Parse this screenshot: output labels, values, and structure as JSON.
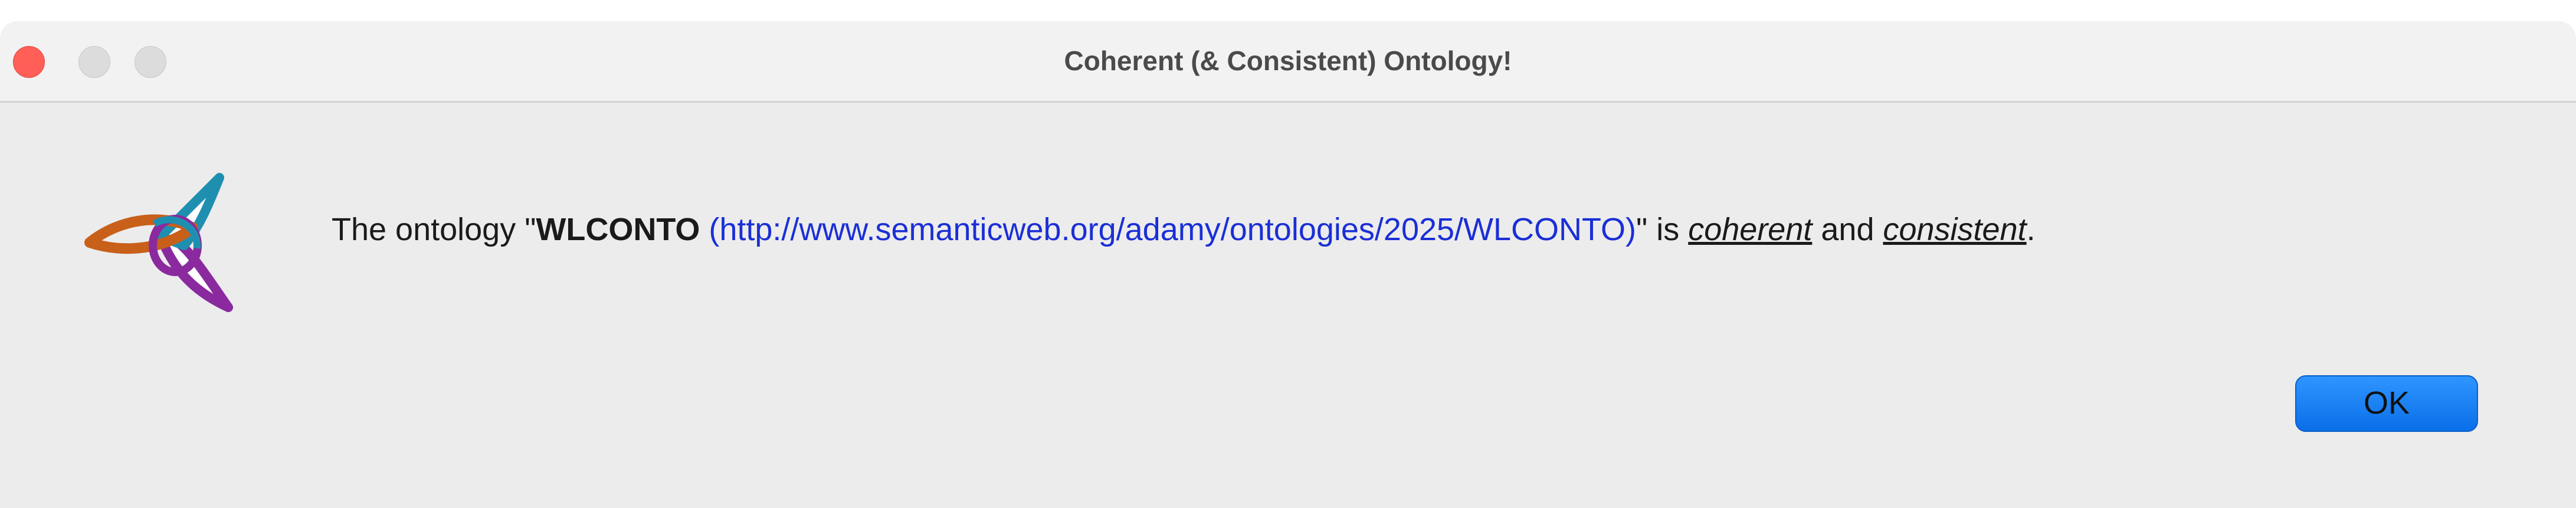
{
  "window": {
    "title": "Coherent (& Consistent) Ontology!"
  },
  "message": {
    "prefix": "The ontology \"",
    "ontology_name": "WLCONTO",
    "space": " ",
    "iri": "(http://www.semanticweb.org/adamy/ontologies/2025/WLCONTO)",
    "mid": "\" is ",
    "term_coherent": "coherent",
    "and": " and ",
    "term_consistent": "consistent",
    "suffix": "."
  },
  "buttons": {
    "ok_label": "OK"
  },
  "icons": {
    "close": "close-traffic-light",
    "minimize": "minimize-traffic-light",
    "zoom": "zoom-traffic-light",
    "logo": "protege-logo-icon"
  },
  "colors": {
    "close": "#ff5f57",
    "inactive_light": "#dcdcdc",
    "iri_link": "#1a2fd6",
    "ok_button": "#1a82fb",
    "logo_orange": "#c8601a",
    "logo_purple": "#8a2a9e",
    "logo_teal": "#1f8fb0"
  }
}
